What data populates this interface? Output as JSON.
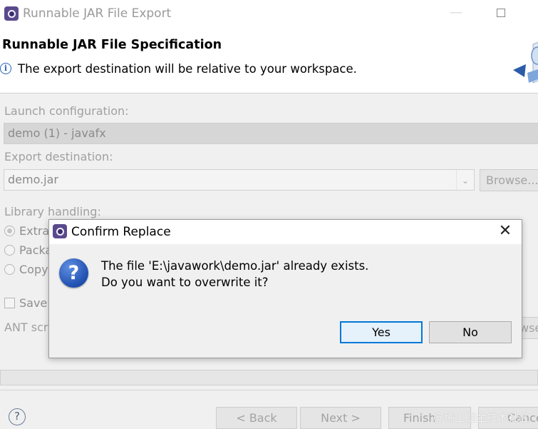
{
  "window": {
    "title": "Runnable JAR File Export",
    "minimize_glyph": "—"
  },
  "header": {
    "title": "Runnable JAR File Specification",
    "info_message": "The export destination will be relative to your workspace."
  },
  "form": {
    "launch_config_label": "Launch configuration:",
    "launch_config_value": "demo (1) - javafx",
    "export_dest_label": "Export destination:",
    "export_dest_value": "demo.jar",
    "browse_label": "Browse...",
    "library_label": "Library handling:",
    "library_options": [
      {
        "label": "Extra",
        "selected": true
      },
      {
        "label": "Packa",
        "selected": false
      },
      {
        "label": "Copy",
        "selected": false
      }
    ],
    "save_label": "Save",
    "ant_label": "ANT scr",
    "ant_browse_fragment": "wse"
  },
  "footer": {
    "back_label": "< Back",
    "next_label": "Next >",
    "finish_label": "Finish",
    "cancel_label": "Cancel",
    "watermark": "@稀土掘金技术社区"
  },
  "dialog": {
    "title": "Confirm Replace",
    "message_line1": "The file 'E:\\javawork\\demo.jar' already exists.",
    "message_line2": "Do you want to overwrite it?",
    "yes_label": "Yes",
    "no_label": "No",
    "close_glyph": "✕",
    "question_glyph": "?"
  },
  "colors": {
    "accent": "#0078d7",
    "disabled_text": "#a0a0a0",
    "question_icon": "#1f4fb0"
  }
}
